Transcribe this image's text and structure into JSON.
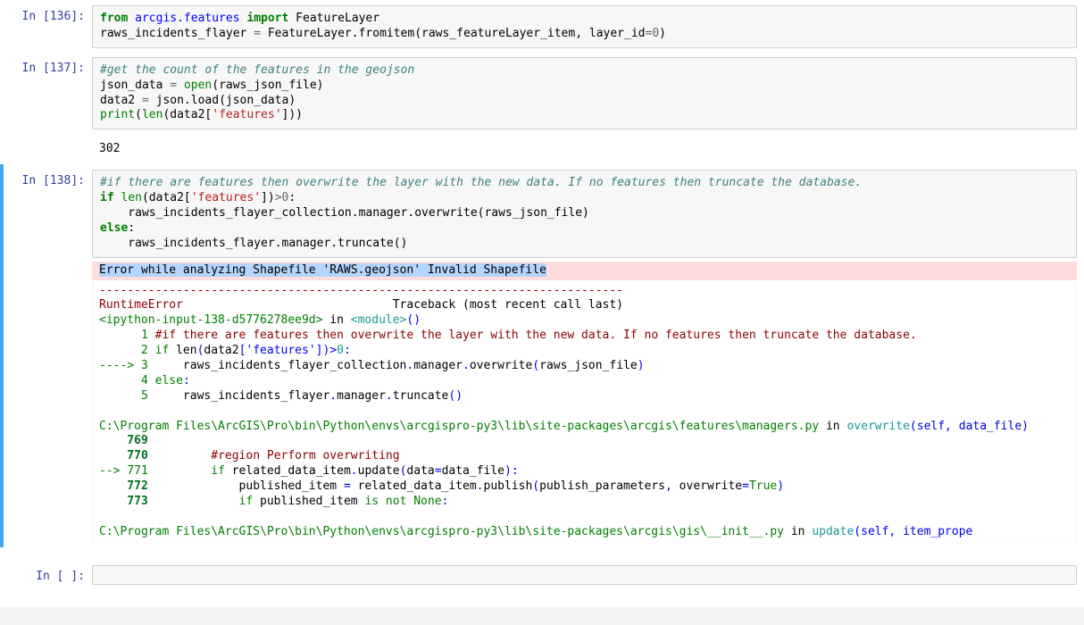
{
  "cells": {
    "c136": {
      "prompt": "In [136]:",
      "code_html": "<span class='k'>from</span> <span class='nn'>arcgis.features</span> <span class='k'>import</span> FeatureLayer\nraws_incidents_flayer <span class='o'>=</span> FeatureLayer.fromitem(raws_featureLayer_item, layer_id<span class='o'>=</span><span class='mi'>0</span>)"
    },
    "c137": {
      "prompt": "In [137]:",
      "code_html": "<span class='c'>#get the count of the features in the geojson</span>\njson_data <span class='o'>=</span> <span class='nb'>open</span>(raws_json_file)\ndata2 <span class='o'>=</span> json.load(json_data)\n<span class='nb'>print</span>(<span class='nb'>len</span>(data2[<span class='s'>'features'</span>]))",
      "output": "302"
    },
    "c138": {
      "prompt": "In [138]:",
      "code_html": "<span class='c'>#if there are features then overwrite the layer with the new data. If no features then truncate the database.</span>\n<span class='k'>if</span> <span class='nb'>len</span>(data2[<span class='s'>'features'</span>])<span class='o'>&gt;</span><span class='mi'>0</span>:\n    raws_incidents_flayer_collection.manager.overwrite(raws_json_file)\n<span class='k'>else</span>:\n    raws_incidents_flayer.manager.truncate()",
      "error_line": "Error while analyzing Shapefile 'RAWS.geojson' Invalid Shapefile",
      "traceback_html": "<span class='ansi-red'>---------------------------------------------------------------------------</span>\n<span class='ansi-red'>RuntimeError</span>                              Traceback (most recent call last)\n<span class='ansi-green'>&lt;ipython-input-138-d5776278ee9d&gt;</span> in <span class='ansi-cyan'>&lt;module&gt;</span><span class='ansi-blue'>()</span>\n<span class='ansi-green'>      1</span> <span class='ansi-red'>#if there are features then overwrite the layer with the new data. If no features then truncate the database.</span>\n<span class='ansi-green'>      2</span> <span class='ansi-green'>if</span> len<span class='ansi-blue'>(</span>data2<span class='ansi-blue'>[</span><span class='ansi-blue'>'features'</span><span class='ansi-blue'>]</span><span class='ansi-blue'>)</span><span class='ansi-blue'>&gt;</span><span class='ansi-cyan'>0</span><span class='ansi-blue'>:</span>\n<span class='ansi-green'>----&gt; 3</span>     raws_incidents_flayer_collection<span class='ansi-blue'>.</span>manager<span class='ansi-blue'>.</span>overwrite<span class='ansi-blue'>(</span>raws_json_file<span class='ansi-blue'>)</span>\n<span class='ansi-green'>      4</span> <span class='ansi-green'>else</span><span class='ansi-blue'>:</span>\n<span class='ansi-green'>      5</span>     raws_incidents_flayer<span class='ansi-blue'>.</span>manager<span class='ansi-blue'>.</span>truncate<span class='ansi-blue'>(</span><span class='ansi-blue'>)</span>\n\n<span class='ansi-green'>C:\\Program Files\\ArcGIS\\Pro\\bin\\Python\\envs\\arcgispro-py3\\lib\\site-packages\\arcgis\\features\\managers.py</span> in <span class='ansi-cyan'>overwrite</span><span class='ansi-blue'>(self, data_file)</span>\n<span class='ansi-green-intense'>    769</span> \n<span class='ansi-green-intense'>    770</span>         <span class='ansi-red'>#region Perform overwriting</span>\n<span class='ansi-green'>--&gt; 771</span>         <span class='ansi-green'>if</span> related_data_item<span class='ansi-blue'>.</span>update<span class='ansi-blue'>(</span>data<span class='ansi-blue'>=</span>data_file<span class='ansi-blue'>)</span><span class='ansi-blue'>:</span>\n<span class='ansi-green-intense'>    772</span>             published_item <span class='ansi-blue'>=</span> related_data_item<span class='ansi-blue'>.</span>publish<span class='ansi-blue'>(</span>publish_parameters<span class='ansi-blue'>,</span> overwrite<span class='ansi-blue'>=</span><span class='ansi-green'>True</span><span class='ansi-blue'>)</span>\n<span class='ansi-green-intense'>    773</span>             <span class='ansi-green'>if</span> published_item <span class='ansi-green'>is</span> <span class='ansi-green'>not</span> <span class='ansi-green'>None</span><span class='ansi-blue'>:</span>\n\n<span class='ansi-green'>C:\\Program Files\\ArcGIS\\Pro\\bin\\Python\\envs\\arcgispro-py3\\lib\\site-packages\\arcgis\\gis\\__init__.py</span> in <span class='ansi-cyan'>update</span><span class='ansi-blue'>(self, item_prope</span>"
    },
    "cEmpty": {
      "prompt": "In [ ]:",
      "code_html": ""
    }
  }
}
